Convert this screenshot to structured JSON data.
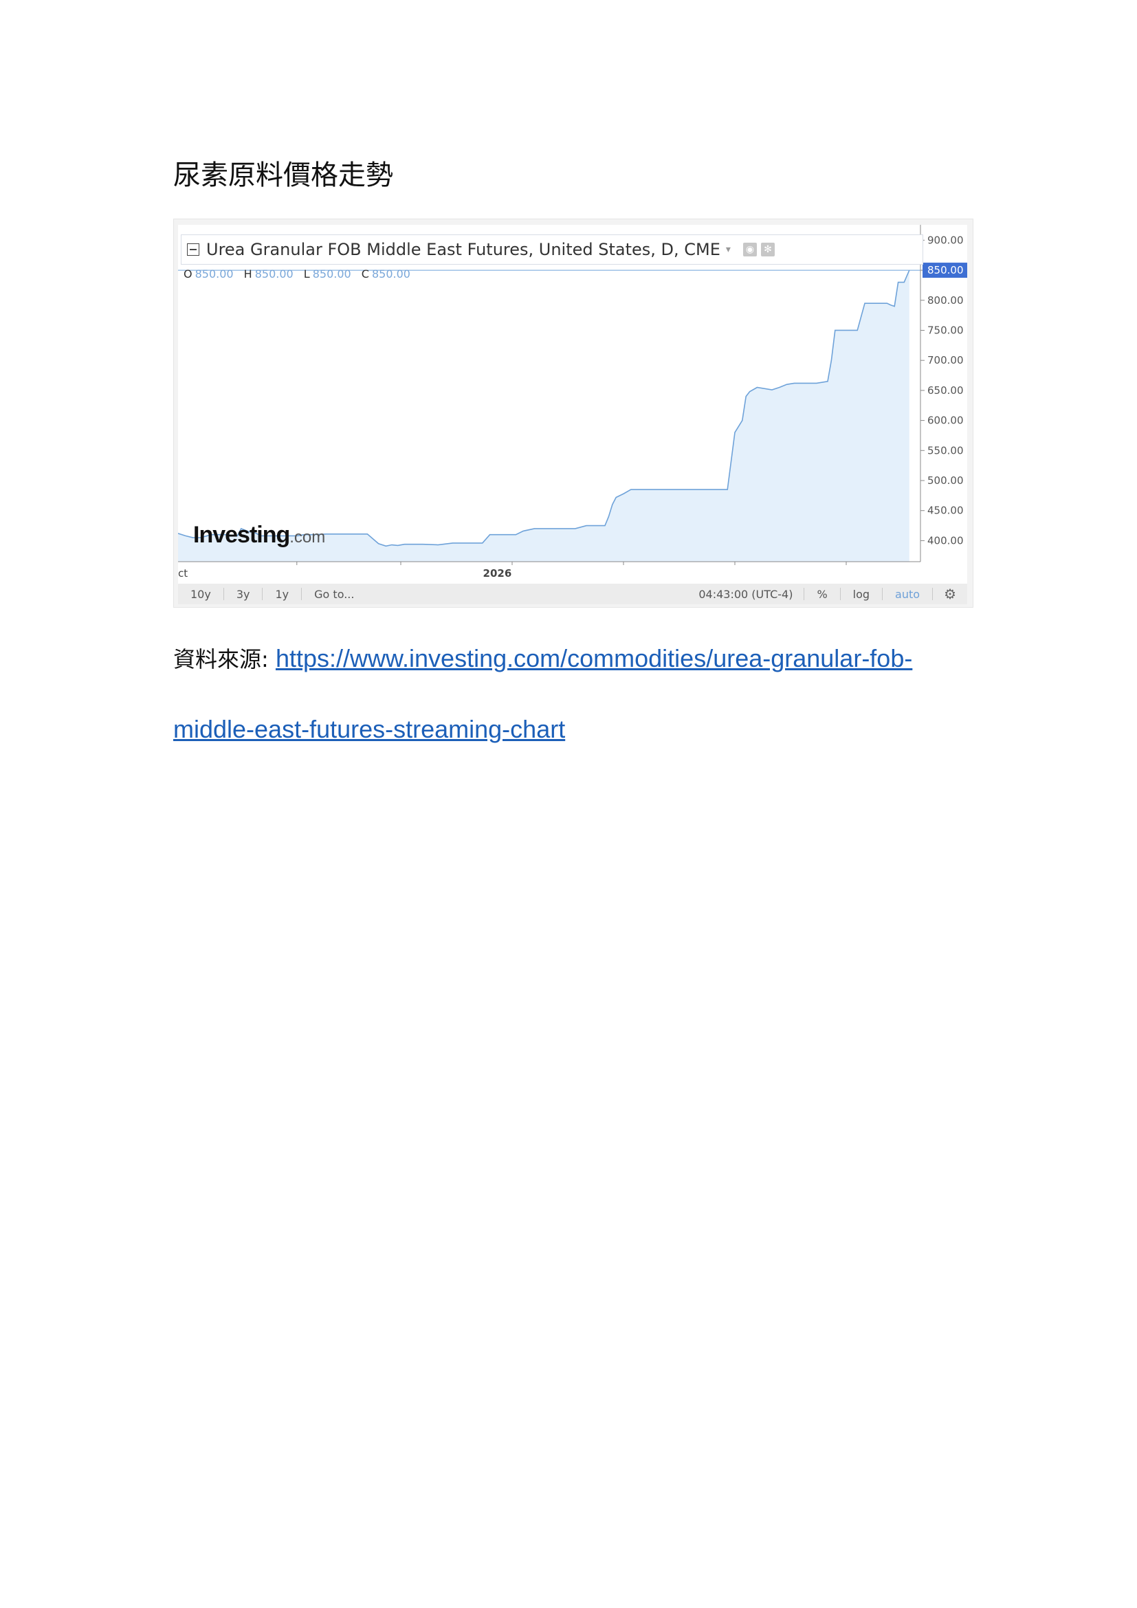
{
  "document": {
    "heading": "尿素原料價格走勢",
    "source_label": "資料來源:",
    "source_link_line1": "https://www.investing.com/commodities/urea-granular-fob-",
    "source_link_line2": "middle-east-futures-streaming-chart"
  },
  "chart_header": {
    "title": "Urea Granular FOB Middle East Futures, United States, D, CME",
    "caret": "▾",
    "eye_icon": "eye-icon",
    "settings_icon": "settings-icon",
    "ohlc": {
      "o_label": "O",
      "o_value": "850.00",
      "h_label": "H",
      "h_value": "850.00",
      "l_label": "L",
      "l_value": "850.00",
      "c_label": "C",
      "c_value": "850.00"
    }
  },
  "logo": {
    "main": "Investing",
    "suffix": ".com"
  },
  "toolbar": {
    "btn_10y": "10y",
    "btn_3y": "3y",
    "btn_1y": "1y",
    "btn_goto": "Go to...",
    "time": "04:43:00 (UTC-4)",
    "btn_percent": "%",
    "btn_log": "log",
    "btn_auto": "auto",
    "gear_icon": "gear-icon"
  },
  "colors": {
    "line": "#6ea2d9",
    "area_fill": "#e4f0fb",
    "last_price_badge": "#3e6fd3",
    "axis_text": "#555555"
  },
  "chart_data": {
    "type": "area",
    "title": "Urea Granular FOB Middle East Futures, United States, D, CME",
    "x_labels": [
      {
        "pos": 0.0,
        "label": "ct"
      },
      {
        "pos": 0.43,
        "label": "2026"
      }
    ],
    "ylim": [
      365,
      905
    ],
    "y_ticks": [
      900,
      850,
      800,
      750,
      700,
      650,
      600,
      550,
      500,
      450,
      400
    ],
    "y_tick_labels": [
      "900.00",
      "850.00",
      "800.00",
      "750.00",
      "700.00",
      "650.00",
      "600.00",
      "550.00",
      "500.00",
      "450.00",
      "400.00"
    ],
    "last_value": 850,
    "last_value_label": "850.00",
    "series": [
      {
        "x": [
          0,
          0.01,
          0.02,
          0.03,
          0.045,
          0.065,
          0.08,
          0.085,
          0.095,
          0.102,
          0.112,
          0.125,
          0.14,
          0.152,
          0.16,
          0.17,
          0.18,
          0.2,
          0.22,
          0.24,
          0.255,
          0.27,
          0.28,
          0.288,
          0.296,
          0.305,
          0.315,
          0.33,
          0.35,
          0.37,
          0.385,
          0.395,
          0.41,
          0.42,
          0.435,
          0.445,
          0.455,
          0.465,
          0.48,
          0.49,
          0.505,
          0.52,
          0.535,
          0.55,
          0.565,
          0.575,
          0.58,
          0.585,
          0.59,
          0.6,
          0.61,
          0.62,
          0.635,
          0.645,
          0.66,
          0.68,
          0.7,
          0.72,
          0.74,
          0.75,
          0.755,
          0.76,
          0.765,
          0.77,
          0.78,
          0.8,
          0.81,
          0.82,
          0.83,
          0.845,
          0.86,
          0.875,
          0.88,
          0.885,
          0.895,
          0.905,
          0.91,
          0.915,
          0.925,
          0.935,
          0.945,
          0.955,
          0.96,
          0.965,
          0.97,
          0.978,
          0.985
        ],
        "values": [
          412,
          408,
          405,
          405,
          410,
          410,
          408,
          420,
          415,
          414,
          408,
          408,
          408,
          408,
          408,
          410,
          410,
          411,
          411,
          411,
          411,
          395,
          391,
          393,
          392,
          394,
          394,
          394,
          393,
          396,
          396,
          396,
          396,
          410,
          410,
          410,
          410,
          416,
          420,
          420,
          420,
          420,
          420,
          425,
          425,
          425,
          440,
          460,
          472,
          478,
          485,
          485,
          485,
          485,
          485,
          485,
          485,
          485,
          485,
          580,
          590,
          600,
          640,
          648,
          655,
          651,
          655,
          660,
          662,
          662,
          662,
          665,
          700,
          750,
          750,
          750,
          750,
          750,
          795,
          795,
          795,
          795,
          792,
          790,
          830,
          830,
          850
        ]
      }
    ]
  }
}
